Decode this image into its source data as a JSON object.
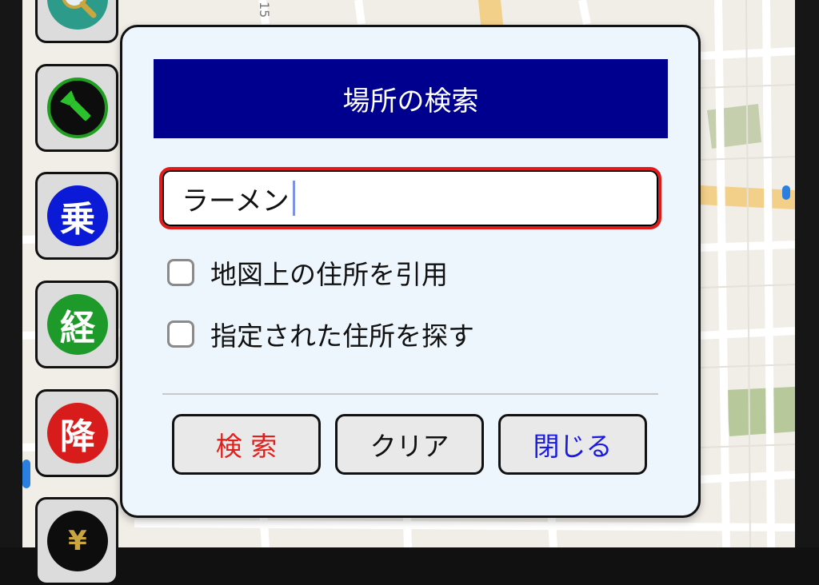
{
  "colors": {
    "dialog_title_bg": "#00008f",
    "search_border": "#e21a1a",
    "search_button_text": "#e0201c",
    "clear_button_text": "#111111",
    "close_button_text": "#1a1ae0",
    "tool_flashlight": "#1f9e1f",
    "tool_board": "#0a1ad6",
    "tool_transfer": "#1e9a2a",
    "tool_alight": "#d81c1c"
  },
  "side_tools": [
    {
      "name": "search-map",
      "icon": "magnifier-icon",
      "label": ""
    },
    {
      "name": "flashlight",
      "icon": "flashlight-icon",
      "label": ""
    },
    {
      "name": "board",
      "icon": "",
      "label": "乗"
    },
    {
      "name": "transfer",
      "icon": "",
      "label": "経"
    },
    {
      "name": "alight",
      "icon": "",
      "label": "降"
    },
    {
      "name": "fare",
      "icon": "yen-coins-icon",
      "label": "¥"
    }
  ],
  "dialog": {
    "title": "場所の検索",
    "search": {
      "value": "ラーメン"
    },
    "options": [
      {
        "label": "地図上の住所を引用",
        "checked": false
      },
      {
        "label": "指定された住所を探す",
        "checked": false
      }
    ],
    "buttons": {
      "search": "検 索",
      "clear": "クリア",
      "close": "閉じる"
    }
  },
  "map": {
    "road_label": "15"
  }
}
